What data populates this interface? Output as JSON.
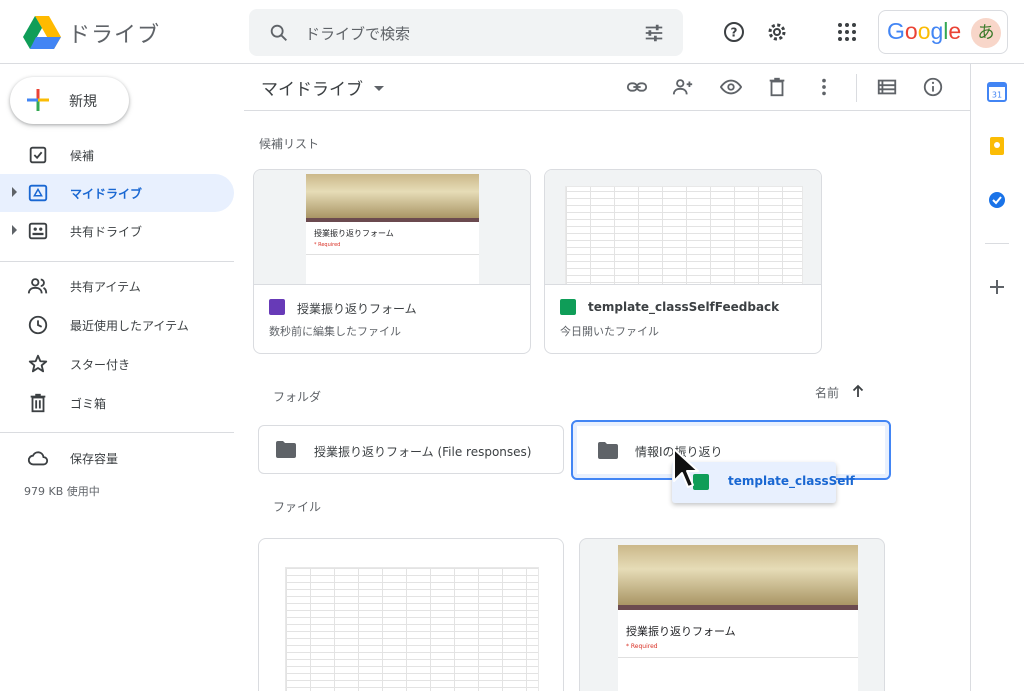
{
  "header": {
    "app_name": "ドライブ",
    "search_placeholder": "ドライブで検索",
    "google_label": "Google",
    "avatar_initial": "あ"
  },
  "nav": {
    "new_label": "新規",
    "items": [
      {
        "label": "候補",
        "icon": "check-box-icon"
      },
      {
        "label": "マイドライブ",
        "icon": "my-drive-icon",
        "active": true
      },
      {
        "label": "共有ドライブ",
        "icon": "shared-drives-icon"
      },
      {
        "label": "共有アイテム",
        "icon": "people-icon"
      },
      {
        "label": "最近使用したアイテム",
        "icon": "clock-icon"
      },
      {
        "label": "スター付き",
        "icon": "star-icon"
      },
      {
        "label": "ゴミ箱",
        "icon": "trash-icon"
      },
      {
        "label": "保存容量",
        "icon": "cloud-icon"
      }
    ],
    "storage_used": "979 KB 使用中"
  },
  "main": {
    "breadcrumb": "マイドライブ",
    "suggested_label": "候補リスト",
    "suggested": [
      {
        "title": "授業振り返りフォーム",
        "subtitle": "数秒前に編集したファイル",
        "type": "form",
        "type_color": "#673ab7"
      },
      {
        "title": "template_classSelfFeedback",
        "subtitle": "今日開いたファイル",
        "type": "sheet",
        "type_color": "#0f9d58"
      }
    ],
    "thumb_form_title": "授業振り返りフォーム",
    "thumb_form_required": "* Required",
    "folders_label": "フォルダ",
    "sort_label": "名前",
    "folders": [
      {
        "name": "授業振り返りフォーム (File responses)"
      },
      {
        "name": "情報Iの振り返り"
      }
    ],
    "drag_item": "template_classSelf",
    "files_label": "ファイル"
  },
  "colors": {
    "accent": "#1967d2",
    "active_bg": "#e8f0fe",
    "selection_border": "#4285f4"
  }
}
